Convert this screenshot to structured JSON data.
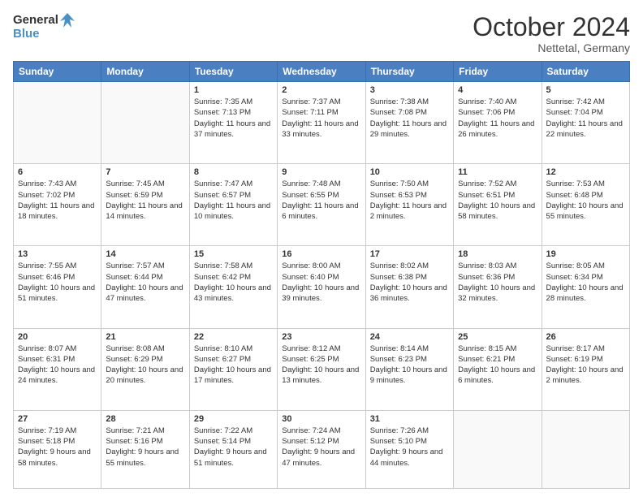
{
  "header": {
    "logo_line1": "General",
    "logo_line2": "Blue",
    "month_title": "October 2024",
    "subtitle": "Nettetal, Germany"
  },
  "days_of_week": [
    "Sunday",
    "Monday",
    "Tuesday",
    "Wednesday",
    "Thursday",
    "Friday",
    "Saturday"
  ],
  "weeks": [
    [
      {
        "day": "",
        "info": ""
      },
      {
        "day": "",
        "info": ""
      },
      {
        "day": "1",
        "info": "Sunrise: 7:35 AM\nSunset: 7:13 PM\nDaylight: 11 hours\nand 37 minutes."
      },
      {
        "day": "2",
        "info": "Sunrise: 7:37 AM\nSunset: 7:11 PM\nDaylight: 11 hours\nand 33 minutes."
      },
      {
        "day": "3",
        "info": "Sunrise: 7:38 AM\nSunset: 7:08 PM\nDaylight: 11 hours\nand 29 minutes."
      },
      {
        "day": "4",
        "info": "Sunrise: 7:40 AM\nSunset: 7:06 PM\nDaylight: 11 hours\nand 26 minutes."
      },
      {
        "day": "5",
        "info": "Sunrise: 7:42 AM\nSunset: 7:04 PM\nDaylight: 11 hours\nand 22 minutes."
      }
    ],
    [
      {
        "day": "6",
        "info": "Sunrise: 7:43 AM\nSunset: 7:02 PM\nDaylight: 11 hours\nand 18 minutes."
      },
      {
        "day": "7",
        "info": "Sunrise: 7:45 AM\nSunset: 6:59 PM\nDaylight: 11 hours\nand 14 minutes."
      },
      {
        "day": "8",
        "info": "Sunrise: 7:47 AM\nSunset: 6:57 PM\nDaylight: 11 hours\nand 10 minutes."
      },
      {
        "day": "9",
        "info": "Sunrise: 7:48 AM\nSunset: 6:55 PM\nDaylight: 11 hours\nand 6 minutes."
      },
      {
        "day": "10",
        "info": "Sunrise: 7:50 AM\nSunset: 6:53 PM\nDaylight: 11 hours\nand 2 minutes."
      },
      {
        "day": "11",
        "info": "Sunrise: 7:52 AM\nSunset: 6:51 PM\nDaylight: 10 hours\nand 58 minutes."
      },
      {
        "day": "12",
        "info": "Sunrise: 7:53 AM\nSunset: 6:48 PM\nDaylight: 10 hours\nand 55 minutes."
      }
    ],
    [
      {
        "day": "13",
        "info": "Sunrise: 7:55 AM\nSunset: 6:46 PM\nDaylight: 10 hours\nand 51 minutes."
      },
      {
        "day": "14",
        "info": "Sunrise: 7:57 AM\nSunset: 6:44 PM\nDaylight: 10 hours\nand 47 minutes."
      },
      {
        "day": "15",
        "info": "Sunrise: 7:58 AM\nSunset: 6:42 PM\nDaylight: 10 hours\nand 43 minutes."
      },
      {
        "day": "16",
        "info": "Sunrise: 8:00 AM\nSunset: 6:40 PM\nDaylight: 10 hours\nand 39 minutes."
      },
      {
        "day": "17",
        "info": "Sunrise: 8:02 AM\nSunset: 6:38 PM\nDaylight: 10 hours\nand 36 minutes."
      },
      {
        "day": "18",
        "info": "Sunrise: 8:03 AM\nSunset: 6:36 PM\nDaylight: 10 hours\nand 32 minutes."
      },
      {
        "day": "19",
        "info": "Sunrise: 8:05 AM\nSunset: 6:34 PM\nDaylight: 10 hours\nand 28 minutes."
      }
    ],
    [
      {
        "day": "20",
        "info": "Sunrise: 8:07 AM\nSunset: 6:31 PM\nDaylight: 10 hours\nand 24 minutes."
      },
      {
        "day": "21",
        "info": "Sunrise: 8:08 AM\nSunset: 6:29 PM\nDaylight: 10 hours\nand 20 minutes."
      },
      {
        "day": "22",
        "info": "Sunrise: 8:10 AM\nSunset: 6:27 PM\nDaylight: 10 hours\nand 17 minutes."
      },
      {
        "day": "23",
        "info": "Sunrise: 8:12 AM\nSunset: 6:25 PM\nDaylight: 10 hours\nand 13 minutes."
      },
      {
        "day": "24",
        "info": "Sunrise: 8:14 AM\nSunset: 6:23 PM\nDaylight: 10 hours\nand 9 minutes."
      },
      {
        "day": "25",
        "info": "Sunrise: 8:15 AM\nSunset: 6:21 PM\nDaylight: 10 hours\nand 6 minutes."
      },
      {
        "day": "26",
        "info": "Sunrise: 8:17 AM\nSunset: 6:19 PM\nDaylight: 10 hours\nand 2 minutes."
      }
    ],
    [
      {
        "day": "27",
        "info": "Sunrise: 7:19 AM\nSunset: 5:18 PM\nDaylight: 9 hours\nand 58 minutes."
      },
      {
        "day": "28",
        "info": "Sunrise: 7:21 AM\nSunset: 5:16 PM\nDaylight: 9 hours\nand 55 minutes."
      },
      {
        "day": "29",
        "info": "Sunrise: 7:22 AM\nSunset: 5:14 PM\nDaylight: 9 hours\nand 51 minutes."
      },
      {
        "day": "30",
        "info": "Sunrise: 7:24 AM\nSunset: 5:12 PM\nDaylight: 9 hours\nand 47 minutes."
      },
      {
        "day": "31",
        "info": "Sunrise: 7:26 AM\nSunset: 5:10 PM\nDaylight: 9 hours\nand 44 minutes."
      },
      {
        "day": "",
        "info": ""
      },
      {
        "day": "",
        "info": ""
      }
    ]
  ]
}
